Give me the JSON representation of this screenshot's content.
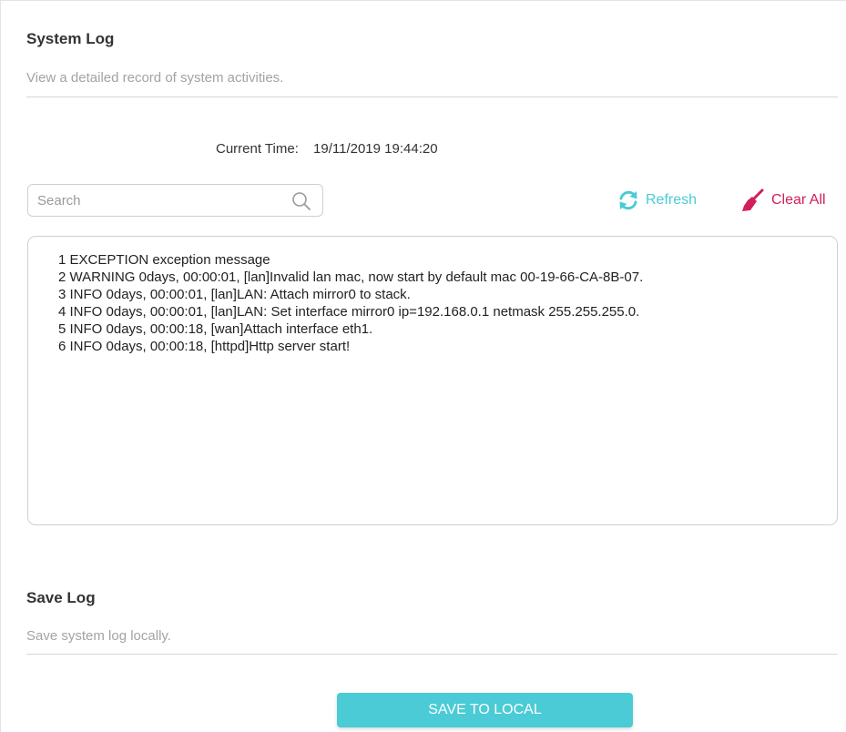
{
  "system_log": {
    "title": "System Log",
    "description": "View a detailed record of system activities.",
    "current_time_label": "Current Time:",
    "current_time_value": "19/11/2019 19:44:20",
    "search": {
      "placeholder": "Search",
      "value": "",
      "icon": "search-icon"
    },
    "refresh_label": "Refresh",
    "refresh_icon": "refresh-icon",
    "clear_all_label": "Clear All",
    "clear_all_icon": "broom-icon",
    "entries": [
      "1 EXCEPTION exception message",
      "2 WARNING 0days, 00:00:01, [lan]Invalid lan mac, now start by default mac 00-19-66-CA-8B-07.",
      "3 INFO 0days, 00:00:01, [lan]LAN: Attach mirror0 to stack.",
      "4 INFO 0days, 00:00:01, [lan]LAN: Set interface mirror0 ip=192.168.0.1 netmask 255.255.255.0.",
      "5 INFO 0days, 00:00:18, [wan]Attach interface eth1.",
      "6 INFO 0days, 00:00:18, [httpd]Http server start!"
    ]
  },
  "save_log": {
    "title": "Save Log",
    "description": "Save system log locally.",
    "button_label": "SAVE TO LOCAL"
  },
  "colors": {
    "accent": "#4acbd6",
    "danger": "#d11f5a",
    "muted_text": "#a3a3a3"
  }
}
